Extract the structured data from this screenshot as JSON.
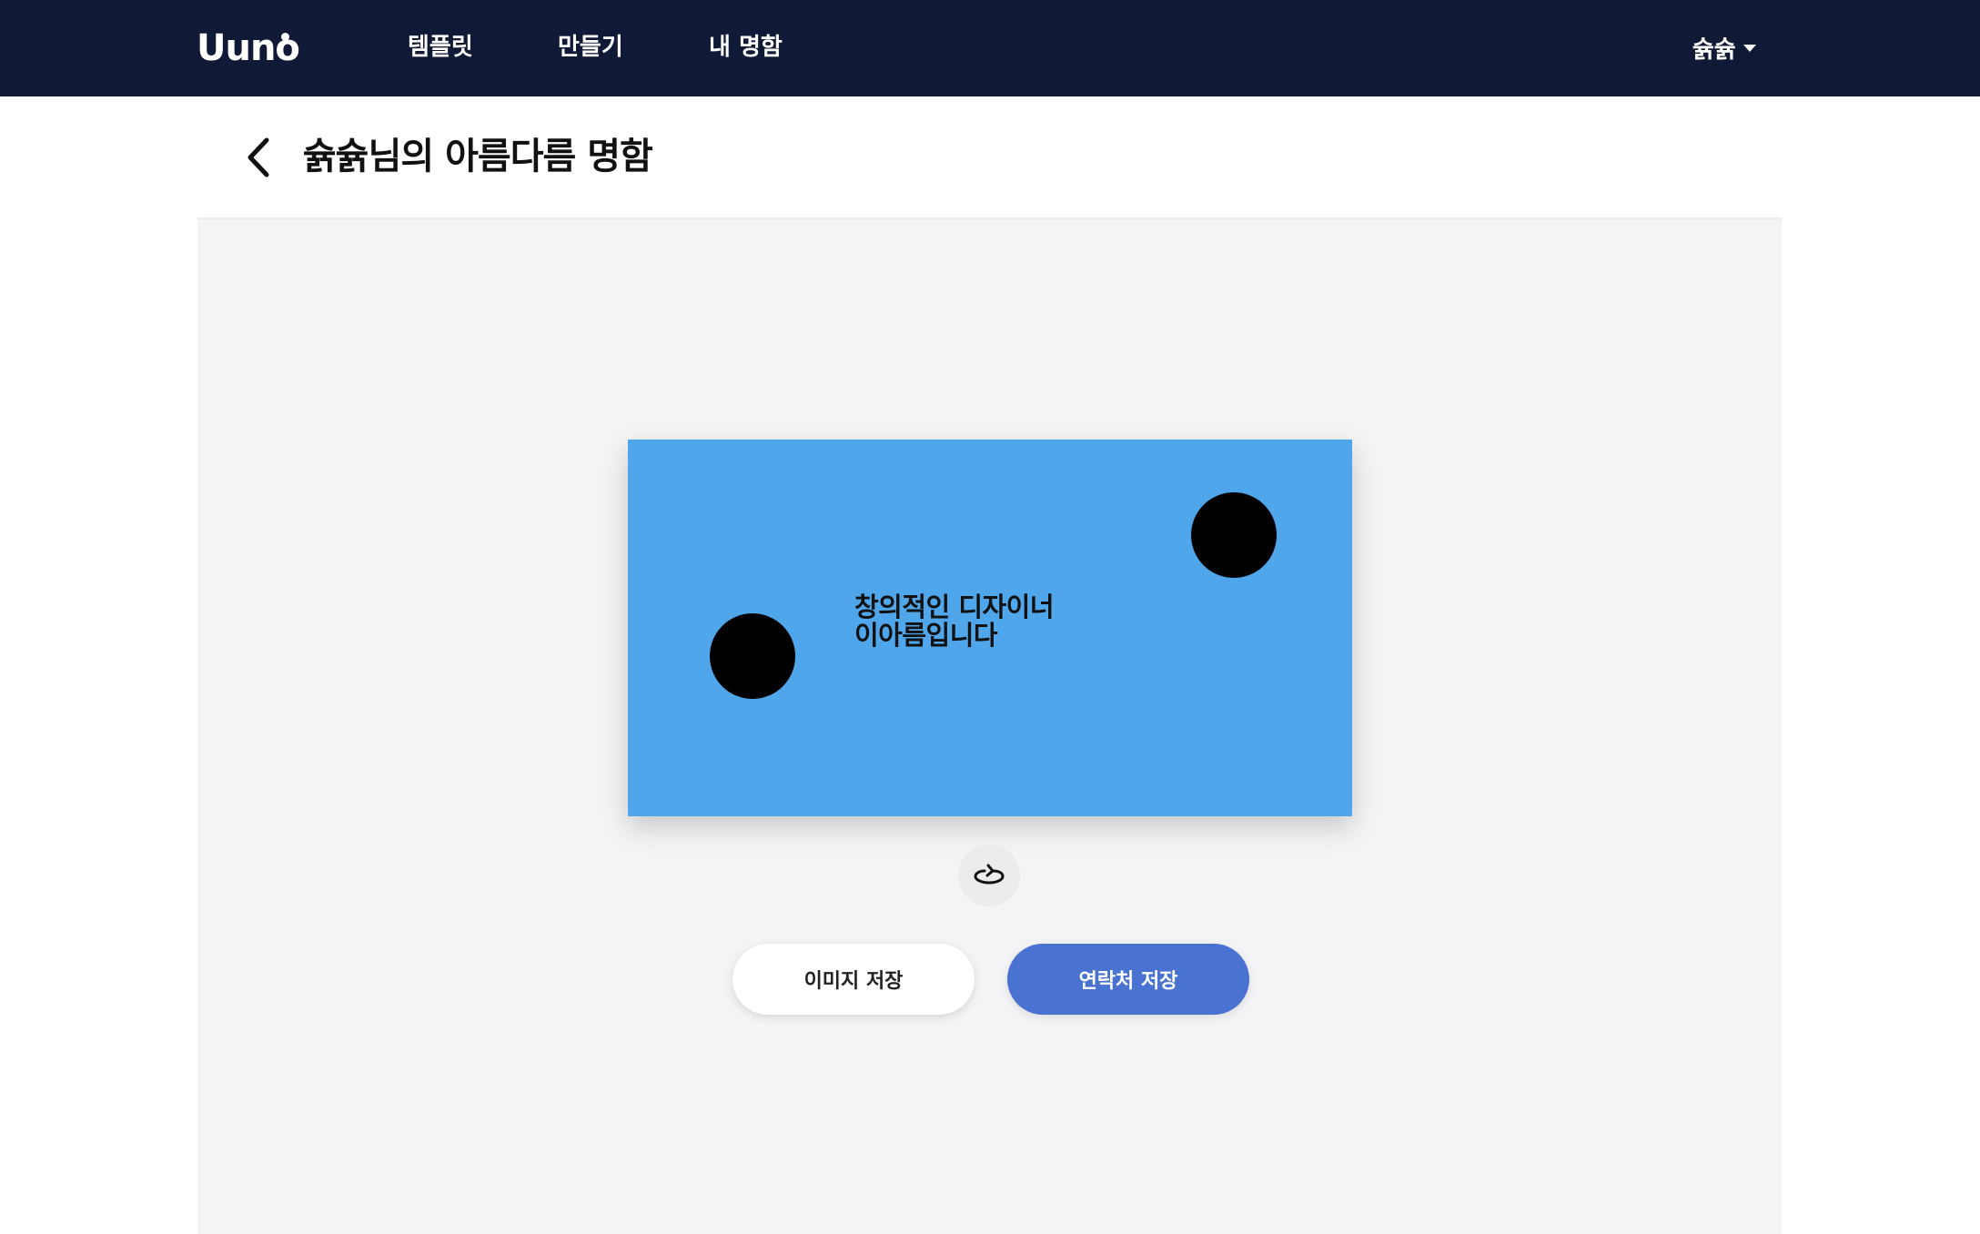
{
  "nav": {
    "logo": "Uuno",
    "items": [
      {
        "label": "템플릿"
      },
      {
        "label": "만들기"
      },
      {
        "label": "내 명함"
      }
    ],
    "user": {
      "name": "슑슑",
      "menu_icon": "caret-down-icon"
    }
  },
  "page": {
    "back_icon": "chevron-left-icon",
    "title": "슑슑님의 아름다름 명함"
  },
  "card": {
    "background_color": "#4fa6ea",
    "text_lines": [
      "창의적인 디자이너",
      "이아름입니다"
    ]
  },
  "actions": {
    "flip_icon": "flip-rotate-icon",
    "save_image_label": "이미지 저장",
    "save_contact_label": "연락처 저장"
  },
  "colors": {
    "nav_bg": "#101a36",
    "primary": "#4a73d1",
    "page_bg": "#f4f4f6"
  }
}
